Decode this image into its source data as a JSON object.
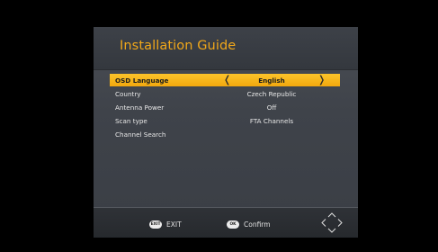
{
  "header": {
    "title": "Installation Guide"
  },
  "menu": {
    "items": [
      {
        "label": "OSD Language",
        "value": "English",
        "selected": true
      },
      {
        "label": "Country",
        "value": "Czech Republic",
        "selected": false
      },
      {
        "label": "Antenna Power",
        "value": "Off",
        "selected": false
      },
      {
        "label": "Scan type",
        "value": "FTA Channels",
        "selected": false
      },
      {
        "label": "Channel Search",
        "value": "",
        "selected": false
      }
    ],
    "arrow_left": "❬",
    "arrow_right": "❭"
  },
  "footer": {
    "exit_key": "EXIT",
    "exit_label": "EXIT",
    "ok_key": "OK",
    "ok_label": "Confirm",
    "dpad_icon": "navigation-dpad-icon"
  },
  "colors": {
    "accent": "#f0a71a",
    "highlight": "#fcc42a",
    "panel": "#45494f",
    "background": "#000000"
  }
}
